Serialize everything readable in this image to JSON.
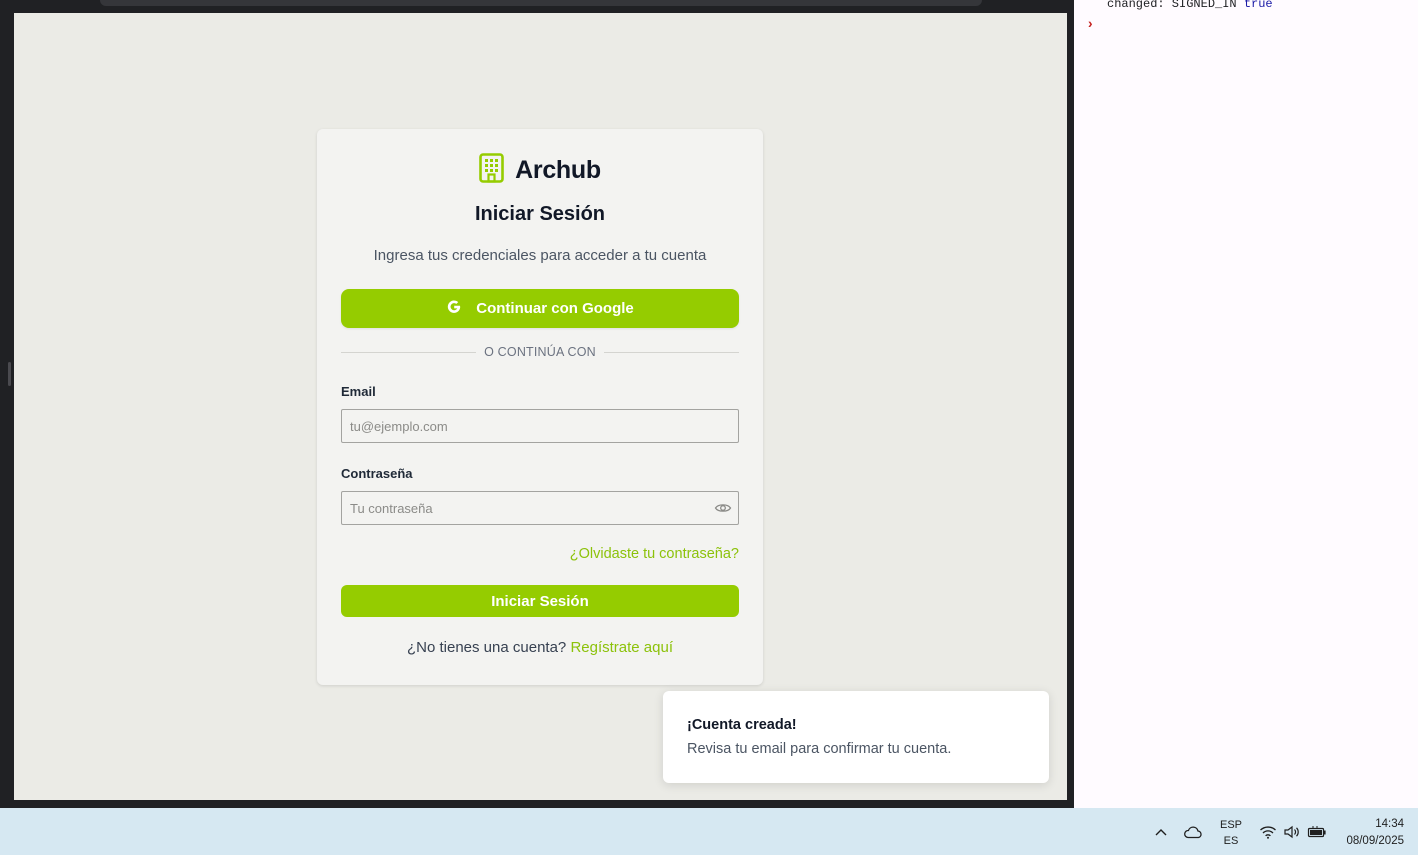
{
  "login": {
    "brand_name": "Archub",
    "title": "Iniciar Sesión",
    "subtitle": "Ingresa tus credenciales para acceder a tu cuenta",
    "google_button_label": "Continuar con Google",
    "divider_text": "O CONTINÚA CON",
    "email_label": "Email",
    "email_value": "",
    "email_placeholder": "tu@ejemplo.com",
    "password_label": "Contraseña",
    "password_value": "",
    "password_placeholder": "Tu contraseña",
    "forgot_password_label": "¿Olvidaste tu contraseña?",
    "submit_label": "Iniciar Sesión",
    "signup_prompt": "¿No tienes una cuenta?",
    "signup_link_label": "Regístrate aquí",
    "accent_color": "#95cc00"
  },
  "toast": {
    "title": "¡Cuenta creada!",
    "description": "Revisa tu email para confirmar tu cuenta."
  },
  "devtools": {
    "console_text": "changed: SIGNED_IN",
    "console_bool": "true",
    "prompt_symbol": "›"
  },
  "taskbar": {
    "language_top": "ESP",
    "language_bottom": "ES",
    "time": "14:34",
    "date": "08/09/2025",
    "tray_icons": [
      "chevron-up-icon",
      "cloud-icon",
      "wifi-icon",
      "volume-icon",
      "battery-icon"
    ]
  }
}
